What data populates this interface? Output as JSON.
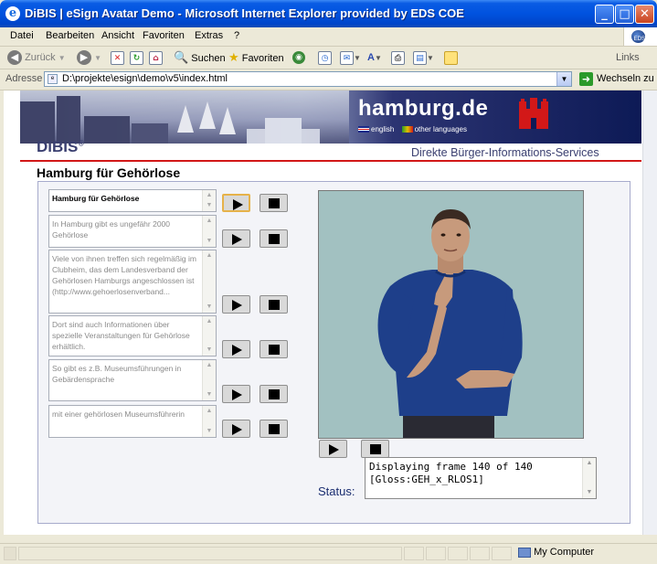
{
  "window": {
    "title": "DiBIS | eSign Avatar Demo - Microsoft Internet Explorer provided by EDS COE",
    "minimize": "_",
    "maximize": "□",
    "close": "✕"
  },
  "menu": {
    "items": [
      "Datei",
      "Bearbeiten",
      "Ansicht",
      "Favoriten",
      "Extras",
      "?"
    ]
  },
  "toolbar": {
    "back_label": "Zurück",
    "search_label": "Suchen",
    "favorites_label": "Favoriten",
    "links_label": "Links"
  },
  "address": {
    "label": "Adresse",
    "value": "D:\\projekte\\esign\\demo\\v5\\index.html",
    "go_label": "Wechseln zu"
  },
  "page": {
    "brand": "hamburg.de",
    "lang_english": "english",
    "lang_other": "other languages",
    "dibis": "DiBIS",
    "dibis_reg": "®",
    "tagline": "Direkte Bürger-Informations-Services",
    "title": "Hamburg für Gehörlose",
    "sentences": [
      "Hamburg für Gehörlose",
      "In Hamburg gibt es ungefähr 2000 Gehörlose",
      "Viele von ihnen treffen sich regelmäßig im Clubheim, das dem Landesverband der Gehörlosen Hamburgs angeschlossen ist (http://www.gehoerlosenverband...",
      "Dort sind auch Informationen über spezielle Veranstaltungen für Gehörlose erhältlich.",
      "So gibt es z.B. Museumsführungen in Gebärdensprache",
      "mit einer gehörlosen Museumsführerin"
    ],
    "status_label": "Status:",
    "status_line1": "Displaying frame 140 of 140",
    "status_line2": "[Gloss:GEH_x_RLOS1]"
  },
  "statusbar": {
    "zone": "My Computer"
  },
  "colors": {
    "titlebar": "#0052df",
    "banner_dark": "#0d1a56",
    "accent_red": "#d21818",
    "panel_border": "#a7abcc",
    "avatar_bg": "#a2c1c1",
    "shirt": "#1e3f8a"
  }
}
